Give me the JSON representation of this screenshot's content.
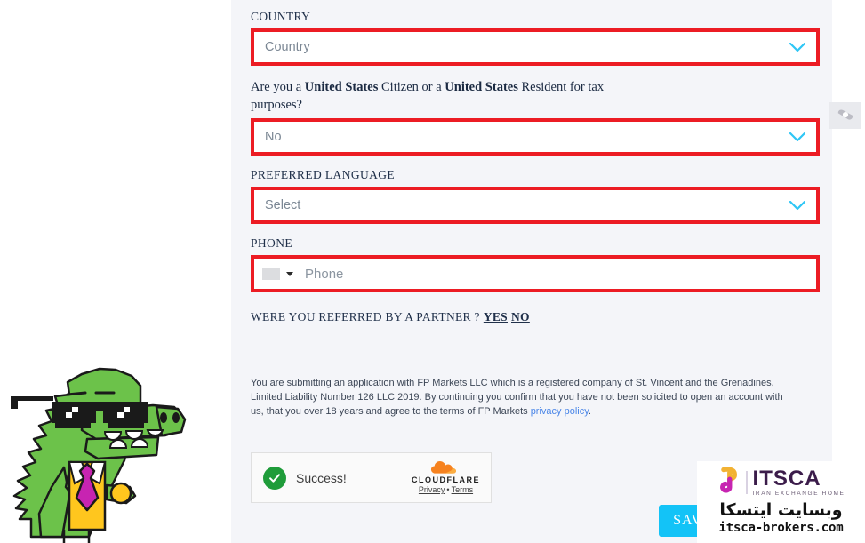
{
  "form": {
    "country": {
      "label": "COUNTRY",
      "value": "Country",
      "icon": "chevron-down-icon"
    },
    "us_tax": {
      "question_prefix": "Are you a ",
      "question_bold1": "United States",
      "question_mid": " Citizen or a ",
      "question_bold2": "United States",
      "question_suffix": " Resident for tax purposes?",
      "value": "No"
    },
    "language": {
      "label": "PREFERRED LANGUAGE",
      "value": "Select"
    },
    "phone": {
      "label": "PHONE",
      "placeholder": "Phone",
      "flag_icon": "blank-flag-icon",
      "caret_icon": "caret-down-icon"
    },
    "referral": {
      "question": "WERE YOU REFERRED BY A PARTNER ?",
      "yes_label": "YES",
      "no_label": "NO"
    },
    "disclaimer": {
      "part1": "You are submitting an application with FP Markets LLC which is a registered company of St. Vincent and the Grenadines, Limited Liability Number 126 LLC 2019. By continuing you confirm that you have not been solicited to open an account with us, that you over 18 years and agree to the terms of FP Markets ",
      "link": "privacy policy",
      "part2": "."
    },
    "save_label": "SAVE"
  },
  "captcha": {
    "status_text": "Success!",
    "check_icon": "success-check-icon",
    "brand": "CLOUDFLARE",
    "cloud_icon": "cloudflare-cloud-icon",
    "privacy_label": "Privacy",
    "separator": "•",
    "terms_label": "Terms"
  },
  "watermark": {
    "brand": "ITSCA",
    "tagline": "IRAN EXCHANGE HOME",
    "persian": "وبسایت ایتسکا",
    "url": "itsca-brokers.com",
    "logo_icon": "itsca-logo-icon"
  },
  "side_badge": {
    "icon": "grey-badge-icon"
  },
  "mascot": {
    "icon": "crocodile-mascot-icon"
  },
  "colors": {
    "highlight_red": "#ec1c24",
    "chevron_cyan": "#2ec6f5",
    "save_blue": "#13c3f7",
    "link_blue": "#4a86e8",
    "success_green": "#1f9c3a",
    "panel_bg": "#f4f5f9"
  }
}
